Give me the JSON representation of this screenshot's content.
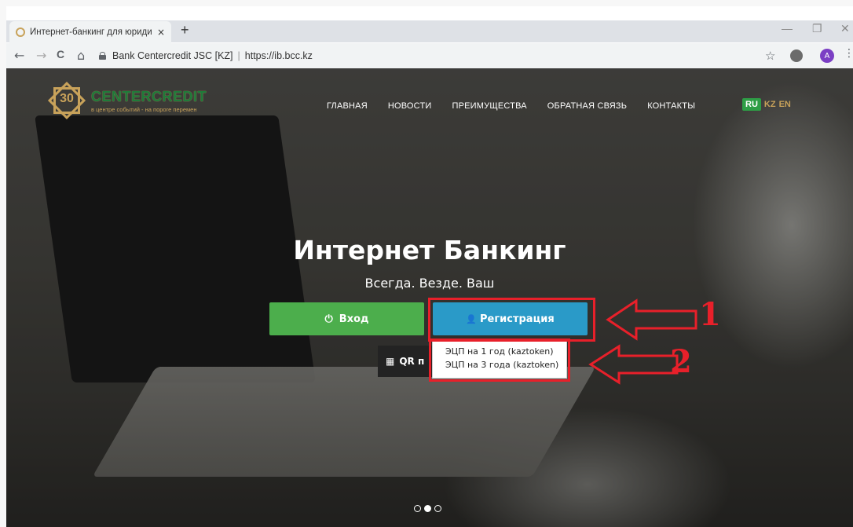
{
  "browser": {
    "tab_title": "Интернет-банкинг для юридиче",
    "tab_close": "×",
    "new_tab": "+",
    "window_controls": [
      "—",
      "❐",
      "✕"
    ],
    "nav": {
      "back": "←",
      "forward": "→",
      "reload": "C",
      "home": "⌂"
    },
    "site_identity": "Bank Centercredit JSC [KZ]",
    "separator": "|",
    "url": "https://ib.bcc.kz",
    "star": "☆",
    "avatar_letter": "A",
    "menu": "⋮"
  },
  "site": {
    "logo": {
      "number": "30",
      "brand": "CENTERCREDIT",
      "slogan": "в центре событий - на пороге перемен"
    },
    "nav": [
      "ГЛАВНАЯ",
      "НОВОСТИ",
      "ПРЕИМУЩЕСТВА",
      "ОБРАТНАЯ СВЯЗЬ",
      "КОНТАКТЫ"
    ],
    "languages": {
      "active": "RU",
      "others": [
        "KZ",
        "EN"
      ]
    },
    "hero": {
      "title": "Интернет Банкинг",
      "subtitle": "Всегда. Везде. Ваш"
    },
    "buttons": {
      "login_icon": "⏻",
      "login": "Вход",
      "register_icon": "👤",
      "register": "Регистрация",
      "qr_icon": "▦",
      "qr": "QR п"
    },
    "dropdown": [
      "ЭЦП на 1 год (kaztoken)",
      "ЭЦП на 3 года (kaztoken)"
    ],
    "carousel": {
      "count": 3,
      "active": 2
    }
  },
  "annotations": [
    "1",
    "2"
  ],
  "colors": {
    "login_green": "#4cae4c",
    "register_blue": "#2a9ac8",
    "annotation_red": "#e8202a",
    "brand_gold": "#c8a25a",
    "brand_green": "#1f7a3a"
  }
}
